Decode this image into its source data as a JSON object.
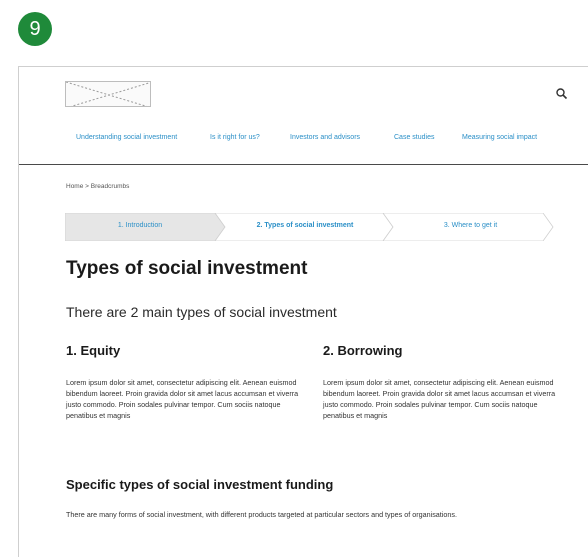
{
  "badge_number": "9",
  "header": {
    "logo_icon": "image-placeholder",
    "search_icon": "search-icon",
    "nav": [
      "Understanding social investment",
      "Is it right for us?",
      "Investors and advisors",
      "Case studies",
      "Measuring social impact"
    ]
  },
  "breadcrumb": "Home  >  Breadcrumbs",
  "steps": [
    {
      "label": "1. Introduction",
      "active": false
    },
    {
      "label": "2. Types of social investment",
      "active": true
    },
    {
      "label": "3. Where to get it",
      "active": false
    }
  ],
  "page": {
    "title": "Types of social investment",
    "intro": "There are 2 main types of social investment",
    "columns": [
      {
        "heading": "1. Equity",
        "body": "Lorem ipsum dolor sit amet, consectetur adipiscing elit. Aenean euismod bibendum laoreet. Proin gravida dolor sit amet lacus accumsan et viverra justo commodo. Proin sodales pulvinar tempor. Cum sociis natoque penatibus et magnis"
      },
      {
        "heading": "2. Borrowing",
        "body": "Lorem ipsum dolor sit amet, consectetur adipiscing elit. Aenean euismod bibendum laoreet. Proin gravida dolor sit amet lacus accumsan et viverra justo commodo. Proin sodales pulvinar tempor. Cum sociis natoque penatibus et magnis"
      }
    ],
    "subheading": "Specific types of social investment funding",
    "footer_text": "There are many forms of social investment, with different products targeted at particular sectors and types of organisations."
  },
  "colors": {
    "badge": "#1f8a3a",
    "link": "#2a8fc7",
    "step_inactive": "#e6e6e6",
    "step_active": "#ffffff"
  }
}
